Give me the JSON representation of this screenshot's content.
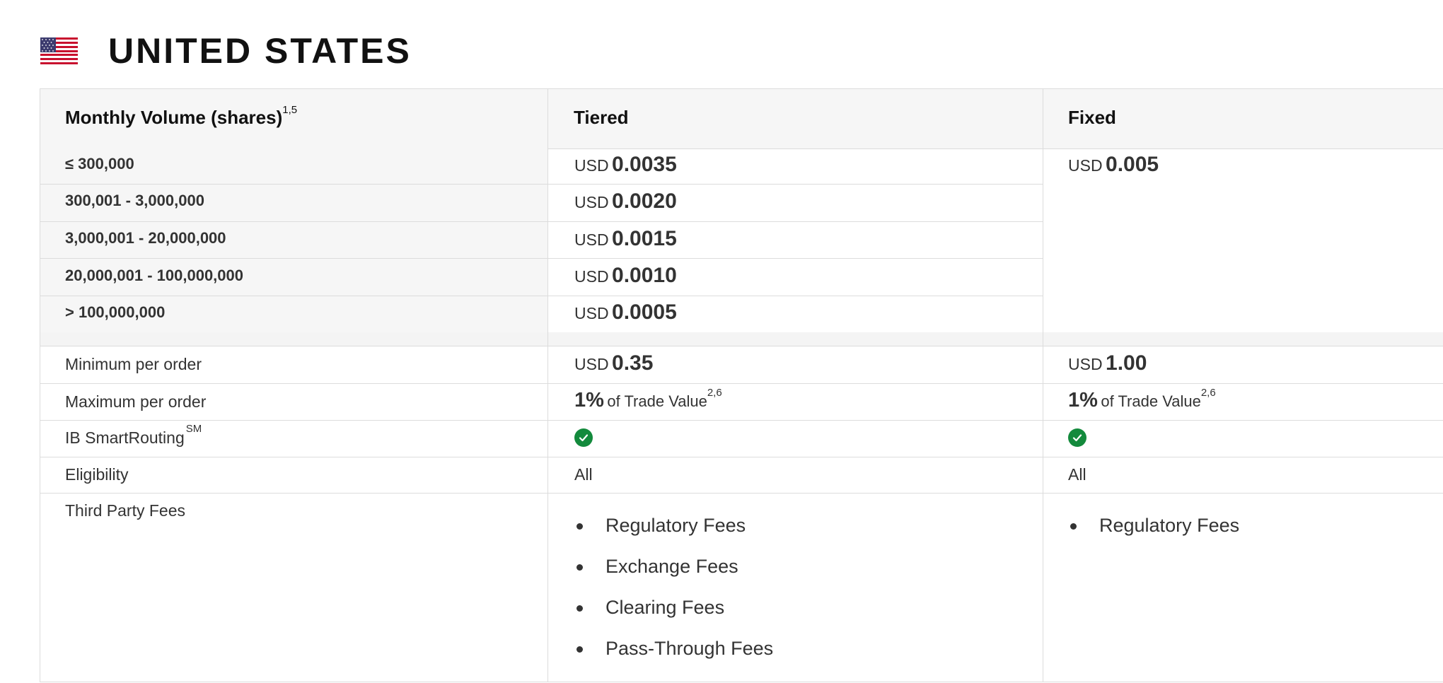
{
  "page": {
    "country": "UNITED STATES",
    "flag_icon": "us-flag-icon"
  },
  "table": {
    "headers": {
      "volume": "Monthly Volume (shares)",
      "volume_sup": "1,5",
      "tiered": "Tiered",
      "fixed": "Fixed"
    },
    "tiers": [
      {
        "range": "≤ 300,000",
        "currency": "USD",
        "rate": "0.0035"
      },
      {
        "range": "300,001 - 3,000,000",
        "currency": "USD",
        "rate": "0.0020"
      },
      {
        "range": "3,000,001 - 20,000,000",
        "currency": "USD",
        "rate": "0.0015"
      },
      {
        "range": "20,000,001 - 100,000,000",
        "currency": "USD",
        "rate": "0.0010"
      },
      {
        "range": "> 100,000,000",
        "currency": "USD",
        "rate": "0.0005"
      }
    ],
    "fixed_rate": {
      "currency": "USD",
      "rate": "0.005"
    },
    "minimum": {
      "label": "Minimum per order",
      "tiered": {
        "currency": "USD",
        "amount": "0.35"
      },
      "fixed": {
        "currency": "USD",
        "amount": "1.00"
      }
    },
    "maximum": {
      "label": "Maximum per order",
      "tiered": {
        "pct": "1%",
        "text": "of Trade Value",
        "sup": "2,6"
      },
      "fixed": {
        "pct": "1%",
        "text": "of Trade Value",
        "sup": "2,6"
      }
    },
    "smartrouting": {
      "label": "IB SmartRouting",
      "sup": "SM",
      "icon": "check-circle-icon",
      "check_color": "#138a3c"
    },
    "eligibility": {
      "label": "Eligibility",
      "tiered": "All",
      "fixed": "All"
    },
    "third_party": {
      "label": "Third Party Fees",
      "tiered": [
        "Regulatory Fees",
        "Exchange Fees",
        "Clearing Fees",
        "Pass-Through Fees"
      ],
      "fixed": [
        "Regulatory Fees"
      ]
    }
  }
}
